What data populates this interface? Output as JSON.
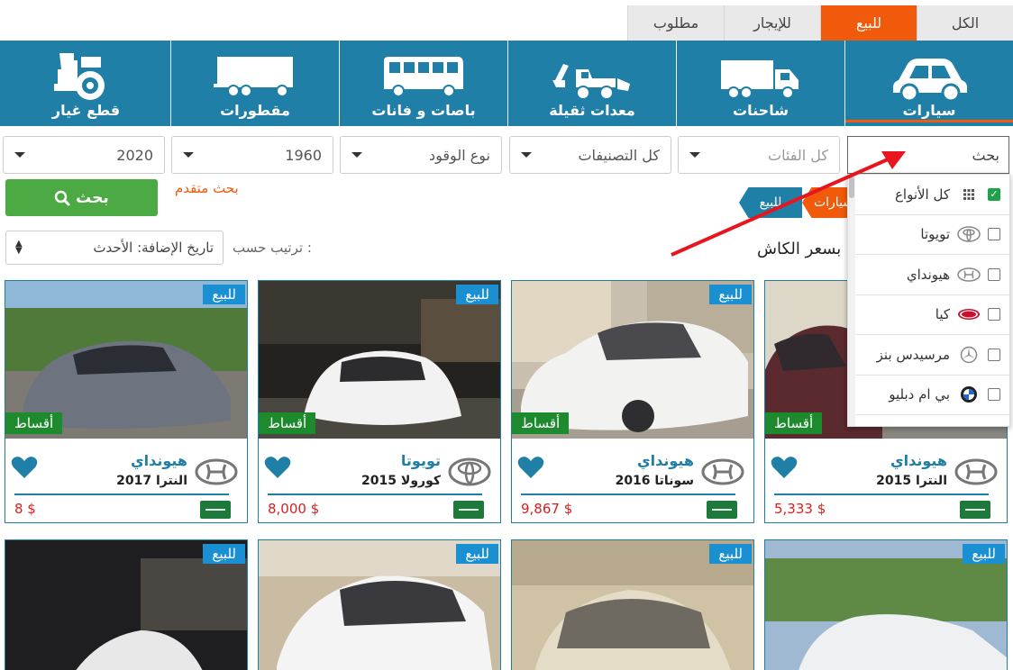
{
  "top_tabs": [
    {
      "label": "الكل"
    },
    {
      "label": "للبيع",
      "active": true
    },
    {
      "label": "للإيجار"
    },
    {
      "label": "مطلوب"
    }
  ],
  "categories": [
    {
      "label": "سيارات",
      "icon": "car-icon",
      "active": true
    },
    {
      "label": "شاحنات",
      "icon": "truck-icon"
    },
    {
      "label": "معدات ثقيلة",
      "icon": "excavator-icon"
    },
    {
      "label": "باصات و فانات",
      "icon": "bus-icon"
    },
    {
      "label": "مقطورات",
      "icon": "trailer-icon"
    },
    {
      "label": "قطع غيار",
      "icon": "spare-parts-icon"
    }
  ],
  "filters": {
    "search_value": "بحث",
    "category": "كل الفئات",
    "classification": "كل التصنيفات",
    "fuel": "نوع الوقود",
    "year_from": "1960",
    "year_to": "2020"
  },
  "search_button": "بحث",
  "advanced_search": "بحث متقدم",
  "breadcrumb": [
    "سيارات",
    "للبيع"
  ],
  "sort": {
    "label": "ترتيب حسب :",
    "value": "تاريخ الإضافة: الأحدث"
  },
  "cash_label": "بسعر الكاش",
  "dropdown": [
    {
      "label": "كل الأنواع",
      "checked": true,
      "logo": "grid-icon"
    },
    {
      "label": "تويوتا",
      "checked": false,
      "logo": "toyota-logo-icon"
    },
    {
      "label": "هيونداي",
      "checked": false,
      "logo": "hyundai-logo-icon"
    },
    {
      "label": "كيا",
      "checked": false,
      "logo": "kia-logo-icon"
    },
    {
      "label": "مرسيدس بنز",
      "checked": false,
      "logo": "mercedes-logo-icon"
    },
    {
      "label": "بي ام دبليو",
      "checked": false,
      "logo": "bmw-logo-icon"
    }
  ],
  "badges": {
    "sale": "للبيع",
    "installment": "أقساط"
  },
  "cards": [
    {
      "make": "هيونداي",
      "model": "النترا 2015",
      "price": "5,333 $",
      "logo": "hyundai"
    },
    {
      "make": "هيونداي",
      "model": "سوناتا 2016",
      "price": "9,867 $",
      "logo": "hyundai"
    },
    {
      "make": "تويوتا",
      "model": "كورولا 2015",
      "price": "8,000 $",
      "logo": "toyota"
    },
    {
      "make": "هيونداي",
      "model": "النترا 2017",
      "price": "8 $",
      "logo": "hyundai"
    }
  ],
  "colors": {
    "brand_blue": "#1f7fa6",
    "accent_orange": "#f05a0a",
    "green": "#4caa44",
    "price_red": "#d62020"
  }
}
